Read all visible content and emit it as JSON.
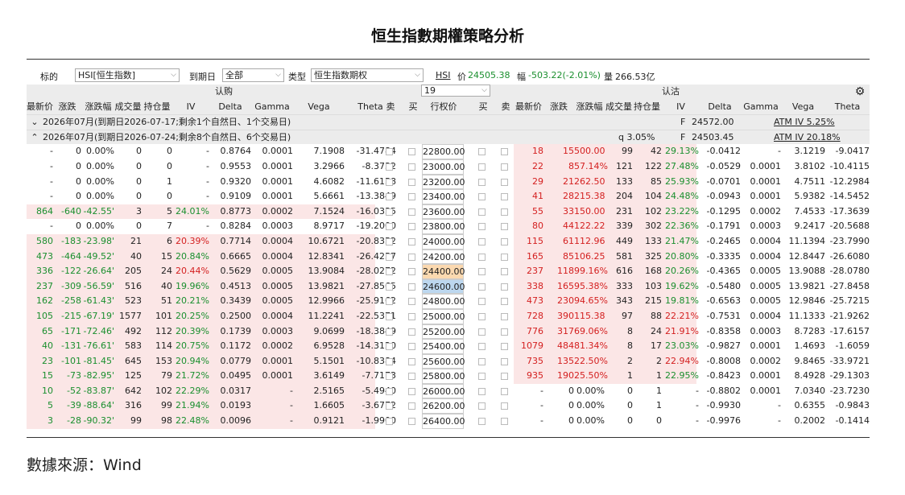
{
  "title": "恒生指數期權策略分析",
  "source": "數據來源：Wind",
  "toolbar": {
    "underlying_label": "标的",
    "underlying_value": "HSI[恒生指数]",
    "expiry_label": "到期日",
    "expiry_value": "全部",
    "type_label": "类型",
    "type_value": "恒生指数期权",
    "ticker": "HSI",
    "price_label": "价",
    "price": "24505.38",
    "change_label": "幅",
    "change": "-503.22(-2.01%)",
    "volume_label": "量",
    "volume": "266.53亿"
  },
  "panel": {
    "call_label": "认购",
    "put_label": "认沽",
    "strike_count": "19",
    "columns": {
      "call": [
        "最新价",
        "涨跌",
        "涨跌幅",
        "成交量",
        "持仓量",
        "IV",
        "Delta",
        "Gamma",
        "Vega",
        "Theta",
        "卖",
        "买"
      ],
      "strike": "行权价",
      "put": [
        "买",
        "卖",
        "最新价",
        "涨跌",
        "涨跌幅",
        "成交量",
        "持仓量",
        "IV",
        "Delta",
        "Gamma",
        "Vega",
        "Theta"
      ]
    },
    "groups": [
      {
        "label": "2026年07月(到期日2026-07-17;剩余1个自然日、1个交易日)",
        "f_label": "F",
        "f_value": "24572.00",
        "atm": "ATM IV 5.25%",
        "q": "",
        "expanded": false
      },
      {
        "label": "2026年07月(到期日2026-07-24;剩余8个自然日、6个交易日)",
        "f_label": "F",
        "f_value": "24503.45",
        "atm": "ATM IV 20.18%",
        "q": "q  3.05%",
        "expanded": true
      }
    ],
    "rows": [
      {
        "c": [
          "-",
          "0",
          "0.00%",
          "0",
          "0",
          "-",
          "0.8764",
          "0.0001",
          "7.1908",
          "-31.4784"
        ],
        "k": "22800.00",
        "p": [
          "18",
          "15",
          "500.00",
          "99",
          "42",
          "29.13%",
          "-0.0412",
          "-",
          "3.1219",
          "-9.0417"
        ],
        "cdir": "flat",
        "pdir": "up",
        "civ": "flat",
        "piv": "green"
      },
      {
        "c": [
          "-",
          "0",
          "0.00%",
          "0",
          "0",
          "-",
          "0.9553",
          "0.0001",
          "3.2966",
          "-8.3732"
        ],
        "k": "23000.00",
        "p": [
          "22",
          "8",
          "57.14%",
          "121",
          "122",
          "27.48%",
          "-0.0529",
          "0.0001",
          "3.8102",
          "-10.4115"
        ],
        "cdir": "flat",
        "pdir": "up",
        "civ": "flat",
        "piv": "green"
      },
      {
        "c": [
          "-",
          "0",
          "0.00%",
          "0",
          "1",
          "-",
          "0.9320",
          "0.0001",
          "4.6082",
          "-11.6158"
        ],
        "k": "23200.00",
        "p": [
          "29",
          "21",
          "262.50",
          "133",
          "85",
          "25.93%",
          "-0.0701",
          "0.0001",
          "4.7511",
          "-12.2984"
        ],
        "cdir": "flat",
        "pdir": "up",
        "civ": "flat",
        "piv": "green"
      },
      {
        "c": [
          "-",
          "0",
          "0.00%",
          "0",
          "0",
          "-",
          "0.9109",
          "0.0001",
          "5.6661",
          "-13.3849"
        ],
        "k": "23400.00",
        "p": [
          "41",
          "28",
          "215.38",
          "204",
          "104",
          "24.48%",
          "-0.0943",
          "0.0001",
          "5.9382",
          "-14.5452"
        ],
        "cdir": "flat",
        "pdir": "up",
        "civ": "flat",
        "piv": "green"
      },
      {
        "c": [
          "864",
          "-640",
          "-42.55'",
          "3",
          "5",
          "24.01%",
          "0.8773",
          "0.0002",
          "7.1524",
          "-16.0335"
        ],
        "k": "23600.00",
        "p": [
          "55",
          "33",
          "150.00",
          "231",
          "102",
          "23.22%",
          "-0.1295",
          "0.0002",
          "7.4533",
          "-17.3639"
        ],
        "cdir": "down",
        "pdir": "up",
        "civ": "green",
        "piv": "green"
      },
      {
        "c": [
          "-",
          "0",
          "0.00%",
          "0",
          "7",
          "-",
          "0.8284",
          "0.0003",
          "8.9717",
          "-19.2000"
        ],
        "k": "23800.00",
        "p": [
          "80",
          "44",
          "122.22",
          "339",
          "302",
          "22.36%",
          "-0.1791",
          "0.0003",
          "9.2417",
          "-20.5688"
        ],
        "cdir": "flat",
        "pdir": "up",
        "civ": "flat",
        "piv": "green"
      },
      {
        "c": [
          "580",
          "-183",
          "-23.98'",
          "21",
          "6",
          "20.39%",
          "0.7714",
          "0.0004",
          "10.6721",
          "-20.8352"
        ],
        "k": "24000.00",
        "p": [
          "115",
          "61",
          "112.96",
          "449",
          "133",
          "21.47%",
          "-0.2465",
          "0.0004",
          "11.1394",
          "-23.7990"
        ],
        "cdir": "down",
        "pdir": "up",
        "civ": "red",
        "piv": "green"
      },
      {
        "c": [
          "473",
          "-464",
          "-49.52'",
          "40",
          "15",
          "20.84%",
          "0.6665",
          "0.0004",
          "12.8341",
          "-26.4257"
        ],
        "k": "24200.00",
        "p": [
          "165",
          "85",
          "106.25",
          "581",
          "325",
          "20.80%",
          "-0.3335",
          "0.0004",
          "12.8447",
          "-26.6080"
        ],
        "cdir": "down",
        "pdir": "up",
        "civ": "green",
        "piv": "green"
      },
      {
        "c": [
          "336",
          "-122",
          "-26.64'",
          "205",
          "24",
          "20.44%",
          "0.5629",
          "0.0005",
          "13.9084",
          "-28.0272"
        ],
        "k": "24400.00",
        "p": [
          "237",
          "118",
          "99.16%",
          "616",
          "168",
          "20.26%",
          "-0.4365",
          "0.0005",
          "13.9088",
          "-28.0780"
        ],
        "cdir": "down",
        "pdir": "up",
        "civ": "red",
        "piv": "green",
        "khl": "orange"
      },
      {
        "c": [
          "237",
          "-309",
          "-56.59'",
          "516",
          "40",
          "19.96%",
          "0.4513",
          "0.0005",
          "13.9821",
          "-27.8565"
        ],
        "k": "24600.00",
        "p": [
          "338",
          "165",
          "95.38%",
          "333",
          "103",
          "19.62%",
          "-0.5480",
          "0.0005",
          "13.9821",
          "-27.8458"
        ],
        "cdir": "down",
        "pdir": "up",
        "civ": "green",
        "piv": "green",
        "khl": "blue"
      },
      {
        "c": [
          "162",
          "-258",
          "-61.43'",
          "523",
          "51",
          "20.21%",
          "0.3439",
          "0.0005",
          "12.9966",
          "-25.9162"
        ],
        "k": "24800.00",
        "p": [
          "473",
          "230",
          "94.65%",
          "343",
          "215",
          "19.81%",
          "-0.6563",
          "0.0005",
          "12.9846",
          "-25.7215"
        ],
        "cdir": "down",
        "pdir": "up",
        "civ": "green",
        "piv": "green"
      },
      {
        "c": [
          "105",
          "-215",
          "-67.19'",
          "1577",
          "101",
          "20.25%",
          "0.2500",
          "0.0004",
          "11.2241",
          "-22.5371"
        ],
        "k": "25000.00",
        "p": [
          "728",
          "390",
          "115.38",
          "97",
          "88",
          "22.21%",
          "-0.7531",
          "0.0004",
          "11.1333",
          "-21.9262"
        ],
        "cdir": "down",
        "pdir": "up",
        "civ": "green",
        "piv": "red"
      },
      {
        "c": [
          "65",
          "-171",
          "-72.46'",
          "492",
          "112",
          "20.39%",
          "0.1739",
          "0.0003",
          "9.0699",
          "-18.3849"
        ],
        "k": "25200.00",
        "p": [
          "776",
          "317",
          "69.06%",
          "8",
          "24",
          "21.91%",
          "-0.8358",
          "0.0003",
          "8.7283",
          "-17.6157"
        ],
        "cdir": "down",
        "pdir": "up",
        "civ": "green",
        "piv": "red"
      },
      {
        "c": [
          "40",
          "-131",
          "-76.61'",
          "583",
          "114",
          "20.75%",
          "0.1172",
          "0.0002",
          "6.9528",
          "-14.3120"
        ],
        "k": "25400.00",
        "p": [
          "1079",
          "484",
          "81.34%",
          "8",
          "17",
          "23.03%",
          "-0.9827",
          "0.0001",
          "1.4693",
          "-1.6059"
        ],
        "cdir": "down",
        "pdir": "up",
        "civ": "green",
        "piv": "green"
      },
      {
        "c": [
          "23",
          "-101",
          "-81.45'",
          "645",
          "153",
          "20.94%",
          "0.0779",
          "0.0001",
          "5.1501",
          "-10.8384"
        ],
        "k": "25600.00",
        "p": [
          "735",
          "135",
          "22.50%",
          "2",
          "2",
          "22.94%",
          "-0.8008",
          "0.0002",
          "9.8465",
          "-33.9721"
        ],
        "cdir": "down",
        "pdir": "up",
        "civ": "green",
        "piv": "red"
      },
      {
        "c": [
          "15",
          "-73",
          "-82.95'",
          "125",
          "79",
          "21.72%",
          "0.0495",
          "0.0001",
          "3.6149",
          "-7.7173"
        ],
        "k": "25800.00",
        "p": [
          "935",
          "190",
          "25.50%",
          "1",
          "1",
          "22.95%",
          "-0.8423",
          "0.0001",
          "8.4928",
          "-29.1303"
        ],
        "cdir": "down",
        "pdir": "up",
        "civ": "green",
        "piv": "green"
      },
      {
        "c": [
          "10",
          "-52",
          "-83.87'",
          "642",
          "102",
          "22.29%",
          "0.0317",
          "-",
          "2.5165",
          "-5.4940"
        ],
        "k": "26000.00",
        "p": [
          "-",
          "0",
          "0.00%",
          "0",
          "1",
          "-",
          "-0.8802",
          "0.0001",
          "7.0340",
          "-23.7230"
        ],
        "cdir": "down",
        "pdir": "flat",
        "civ": "green",
        "piv": "flat"
      },
      {
        "c": [
          "5",
          "-39",
          "-88.64'",
          "316",
          "99",
          "21.94%",
          "0.0193",
          "-",
          "1.6605",
          "-3.6772"
        ],
        "k": "26200.00",
        "p": [
          "-",
          "0",
          "0.00%",
          "0",
          "1",
          "-",
          "-0.9930",
          "-",
          "0.6355",
          "-0.9843"
        ],
        "cdir": "down",
        "pdir": "flat",
        "civ": "green",
        "piv": "flat"
      },
      {
        "c": [
          "3",
          "-28",
          "-90.32'",
          "99",
          "98",
          "22.48%",
          "0.0096",
          "-",
          "0.9121",
          "-1.9900"
        ],
        "k": "26400.00",
        "p": [
          "-",
          "0",
          "0.00%",
          "0",
          "0",
          "-",
          "-0.9976",
          "-",
          "0.2002",
          "-0.1414"
        ],
        "cdir": "down",
        "pdir": "flat",
        "civ": "green",
        "piv": "flat"
      }
    ]
  }
}
